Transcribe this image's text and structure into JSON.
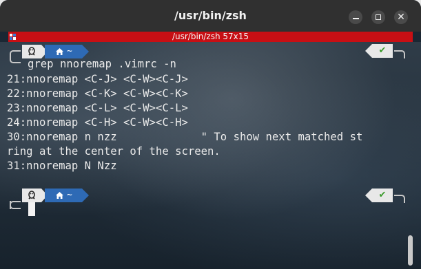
{
  "window": {
    "title": "/usr/bin/zsh",
    "controls": {
      "minimize_icon": "minimize-icon",
      "maximize_icon": "maximize-icon",
      "close_icon": "close-icon"
    }
  },
  "tab": {
    "title": "/usr/bin/zsh 57x15",
    "bar_color": "#c80f14"
  },
  "prompt": {
    "os_icon": "linux-tux-icon",
    "home_icon": "home-icon",
    "dir": "~",
    "status_icon": "checkmark-icon",
    "status_glyph": "✔",
    "status_color": "#3a9a2a",
    "dir_segment_color": "#2e6ab5"
  },
  "terminal": {
    "command": "grep nnoremap .vimrc -n",
    "output": [
      "21:nnoremap <C-J> <C-W><C-J>",
      "22:nnoremap <C-K> <C-W><C-K>",
      "23:nnoremap <C-L> <C-W><C-L>",
      "24:nnoremap <C-H> <C-W><C-H>",
      "30:nnoremap n nzz             \" To show next matched st",
      "ring at the center of the screen.",
      "31:nnoremap N Nzz"
    ]
  }
}
